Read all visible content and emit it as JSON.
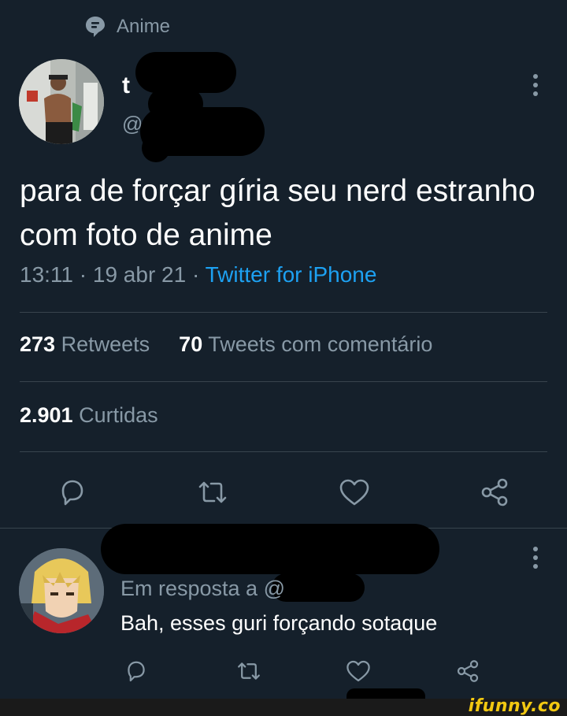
{
  "topic": {
    "label": "Anime",
    "icon": "topic-bubble-icon"
  },
  "tweet": {
    "name": "t",
    "handle": "@",
    "text": "para de forçar gíria seu nerd estranho com foto de anime",
    "time": "13:11 · 19 abr 21 · ",
    "source": "Twitter for iPhone"
  },
  "stats": {
    "retweets_count": "273",
    "retweets_label": "Retweets",
    "quotes_count": "70",
    "quotes_label": "Tweets com comentário",
    "likes_count": "2.901",
    "likes_label": "Curtidas"
  },
  "reply": {
    "in_reply_to": "Em resposta a @",
    "text": "Bah, esses guri forçando sotaque"
  },
  "icons": [
    "reply-icon",
    "retweet-icon",
    "like-icon",
    "share-icon",
    "more-icon"
  ],
  "colors": {
    "background": "#15202b",
    "link": "#1da1f2",
    "muted": "#8899a6",
    "divider": "#38444d",
    "brand": "#f2c811"
  },
  "watermark": "ifunny.co"
}
